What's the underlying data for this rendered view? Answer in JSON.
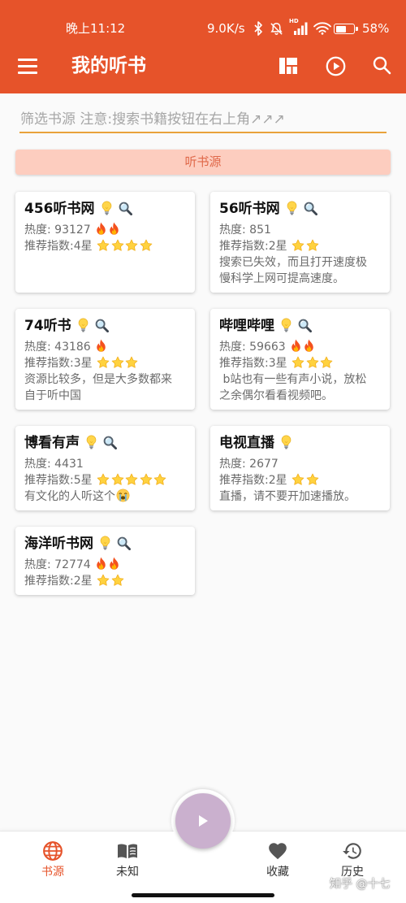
{
  "status_bar": {
    "time": "晚上11:12",
    "net_speed": "9.0K/s",
    "signal_label": "HD",
    "battery_text": "58%",
    "battery_level": 58,
    "icons": [
      "bluetooth-icon",
      "mute-icon",
      "signal-icon",
      "wifi-icon",
      "battery-icon"
    ]
  },
  "app_bar": {
    "title": "我的听书",
    "left_icon": "menu-icon",
    "actions": [
      "layout-icon",
      "play-circle-icon",
      "search-icon"
    ]
  },
  "filter": {
    "placeholder": "筛选书源 注意:搜索书籍按钮在右上角↗↗↗"
  },
  "section_button": {
    "label": "听书源"
  },
  "sources": [
    {
      "name": "456听书网",
      "badges": [
        "lightbulb-icon",
        "magnifier-icon"
      ],
      "heat": "热度: 93127",
      "fire": 2,
      "rating": "推荐指数:4星",
      "stars": 4
    },
    {
      "name": "56听书网",
      "badges": [
        "lightbulb-icon",
        "magnifier-icon"
      ],
      "heat": "热度: 851",
      "fire": 0,
      "rating": "推荐指数:2星",
      "stars": 2,
      "desc": "搜索已失效，而且打开速度极慢科学上网可提高速度。"
    },
    {
      "name": "74听书",
      "badges": [
        "lightbulb-icon",
        "magnifier-icon"
      ],
      "heat": "热度: 43186",
      "fire": 1,
      "rating": "推荐指数:3星",
      "stars": 3,
      "desc": "资源比较多，但是大多数都来自于听中国"
    },
    {
      "name": "哔哩哔哩",
      "badges": [
        "lightbulb-icon",
        "magnifier-icon"
      ],
      "heat": "热度: 59663",
      "fire": 2,
      "rating": "推荐指数:3星",
      "stars": 3,
      "desc": " b站也有一些有声小说，放松之余偶尔看看视频吧。"
    },
    {
      "name": "博看有声",
      "badges": [
        "lightbulb-icon",
        "magnifier-icon"
      ],
      "heat": "热度: 4431",
      "fire": 0,
      "rating": "推荐指数:5星",
      "stars": 5,
      "desc": "有文化的人听这个",
      "desc_icon": "crying-face-icon"
    },
    {
      "name": "电视直播",
      "badges": [
        "lightbulb-icon"
      ],
      "heat": "热度: 2677",
      "fire": 0,
      "rating": "推荐指数:2星",
      "stars": 2,
      "desc": "直播，请不要开加速播放。"
    },
    {
      "name": "海洋听书网",
      "badges": [
        "lightbulb-icon",
        "magnifier-icon"
      ],
      "heat": "热度: 72774",
      "fire": 2,
      "rating": "推荐指数:2星",
      "stars": 2
    }
  ],
  "bottom_nav": {
    "items": [
      {
        "label": "书源",
        "icon": "globe-icon",
        "active": true
      },
      {
        "label": "未知",
        "icon": "book-icon",
        "active": false
      },
      {
        "label": "收藏",
        "icon": "heart-icon",
        "active": false
      },
      {
        "label": "历史",
        "icon": "history-icon",
        "active": false
      }
    ],
    "center_button_icon": "play-icon"
  },
  "watermark": "知乎 @十七",
  "colors": {
    "primary": "#E6532A",
    "banner_bg": "#FDCDBF",
    "banner_text": "#E0694A",
    "fab": "#CAB0CE",
    "secondary_text": "#6B6B6B",
    "filter_underline": "#E9A23B"
  }
}
